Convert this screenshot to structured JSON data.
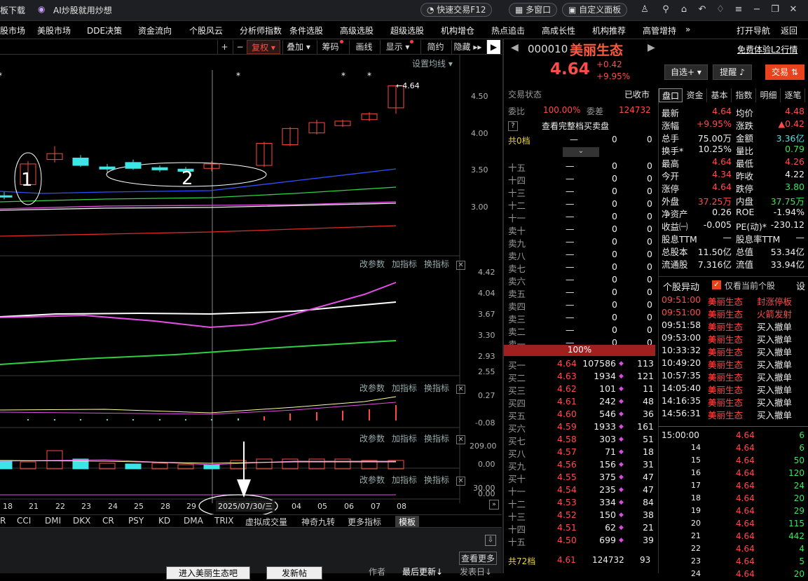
{
  "topbar": {
    "left_label": "板下载",
    "promo": "AI炒股就用炒想",
    "quick_trade": "快速交易F12",
    "multi_window": "多窗口",
    "custom_panel": "自定义面板"
  },
  "menu": [
    "股市场",
    "美股市场",
    "DDE决策",
    "资金流向",
    "个股风云",
    "分析师指数",
    "条件选股",
    "高级选股",
    "超级选股",
    "机构增仓",
    "热点追击",
    "高成长性",
    "机构推荐",
    "高管增持",
    "»",
    "打开导航",
    "返回"
  ],
  "chart_toolbar": {
    "plus": "+",
    "minus": "−",
    "fuquan": "复权",
    "diejia": "叠加",
    "chouma": "筹码",
    "huaxian": "画线",
    "xianshi": "显示",
    "jianyue": "简约",
    "yincang": "隐藏"
  },
  "ma_setting": "设置均线",
  "price_axis": [
    "4.50",
    "4.00",
    "3.50",
    "3.00"
  ],
  "vol_axis": [
    "4.42",
    "4.04",
    "3.67",
    "3.30",
    "2.93",
    "2.55"
  ],
  "p3_axis": [
    "0.27",
    "-0.08"
  ],
  "p4_axis": [
    "209.00",
    "0.00"
  ],
  "p5_axis": [
    "30.00",
    "0.00"
  ],
  "panel_menu": {
    "params": "改参数",
    "add": "加指标",
    "swap": "换指标",
    "close": "X"
  },
  "last_price_label": "4.64",
  "annot1": "1",
  "annot2": "2",
  "x_dates": [
    "18",
    "21",
    "22",
    "23",
    "24",
    "25",
    "28",
    "29",
    "04",
    "05",
    "06",
    "07",
    "08"
  ],
  "cursor_date": "2025/07/30/三",
  "indicator_tabs": [
    "R",
    "CCI",
    "DMI",
    "DKX",
    "CR",
    "PSY",
    "KD",
    "DMA",
    "TRIX",
    "虚拟成交量",
    "神奇九转",
    "更多指标",
    "模板"
  ],
  "bottom": {
    "see_more": "查看更多",
    "enter_bar": "进入美丽生态吧",
    "post": "发新帖",
    "author": "作者",
    "last_update": "最后更新↓",
    "post_date": "发表日↓"
  },
  "chart_data": {
    "type": "candlestick",
    "title": "",
    "candles": [
      {
        "o": 3.15,
        "h": 3.2,
        "l": 3.1,
        "c": 3.13
      },
      {
        "o": 3.3,
        "h": 3.62,
        "l": 3.28,
        "c": 3.58
      },
      {
        "o": 3.64,
        "h": 3.82,
        "l": 3.6,
        "c": 3.72
      },
      {
        "o": 3.66,
        "h": 3.7,
        "l": 3.54,
        "c": 3.56
      },
      {
        "o": 3.54,
        "h": 3.58,
        "l": 3.47,
        "c": 3.51
      },
      {
        "o": 3.6,
        "h": 3.64,
        "l": 3.5,
        "c": 3.52
      },
      {
        "o": 3.53,
        "h": 3.56,
        "l": 3.47,
        "c": 3.5
      },
      {
        "o": 3.51,
        "h": 3.54,
        "l": 3.46,
        "c": 3.48
      },
      {
        "o": 3.52,
        "h": 3.62,
        "l": 3.48,
        "c": 3.58
      },
      {
        "o": 3.56,
        "h": 3.88,
        "l": 3.54,
        "c": 3.86
      },
      {
        "o": 3.84,
        "h": 4.08,
        "l": 3.82,
        "c": 4.06
      },
      {
        "o": 4.0,
        "h": 4.18,
        "l": 3.98,
        "c": 4.14
      },
      {
        "o": 4.1,
        "h": 4.18,
        "l": 4.08,
        "c": 4.16
      },
      {
        "o": 4.18,
        "h": 4.28,
        "l": 4.16,
        "c": 4.26
      },
      {
        "o": 4.34,
        "h": 4.64,
        "l": 4.26,
        "c": 4.64
      }
    ]
  },
  "quote": {
    "code": "000010",
    "name": "美丽生态",
    "trial": "免费体验L2行情",
    "price": "4.64",
    "change": "+0.42",
    "pct": "+9.95%",
    "btn_zixuan": "自选+",
    "btn_tixing": "提醒",
    "btn_jiaoyi": "交易"
  },
  "depth": {
    "status_label": "交易状态",
    "status_val": "已收市",
    "weibi_label": "委比",
    "weibi_val": "100.00%",
    "weicha_label": "委差",
    "weicha_val": "124732",
    "full_link": "查看完整档买卖盘",
    "sell_total_label": "共0档",
    "sell_total_vals": [
      "—",
      "0",
      "0"
    ],
    "sells": [
      [
        "十五",
        "—",
        "0"
      ],
      [
        "十四",
        "—",
        "0"
      ],
      [
        "十三",
        "—",
        "0"
      ],
      [
        "十二",
        "—",
        "0"
      ],
      [
        "十一",
        "—",
        "0"
      ],
      [
        "卖十",
        "—",
        "0"
      ],
      [
        "卖九",
        "—",
        "0"
      ],
      [
        "卖八",
        "—",
        "0"
      ],
      [
        "卖七",
        "—",
        "0"
      ],
      [
        "卖六",
        "—",
        "0"
      ],
      [
        "卖五",
        "—",
        "0"
      ],
      [
        "卖四",
        "—",
        "0"
      ],
      [
        "卖三",
        "—",
        "0"
      ],
      [
        "卖二",
        "—",
        "0"
      ],
      [
        "卖一",
        "—",
        "0"
      ]
    ],
    "sells_count": [
      "0",
      "0",
      "0",
      "0",
      "0",
      "0",
      "0",
      "0",
      "0",
      "0",
      "0",
      "0",
      "0",
      "0",
      "0"
    ],
    "ratio": "100%",
    "buys": [
      [
        "买一",
        "4.64",
        "107586",
        "113"
      ],
      [
        "买二",
        "4.63",
        "1934",
        "121"
      ],
      [
        "买三",
        "4.62",
        "101",
        "11"
      ],
      [
        "买四",
        "4.61",
        "242",
        "48"
      ],
      [
        "买五",
        "4.60",
        "546",
        "36"
      ],
      [
        "买六",
        "4.59",
        "1933",
        "161"
      ],
      [
        "买七",
        "4.58",
        "303",
        "51"
      ],
      [
        "买八",
        "4.57",
        "71",
        "18"
      ],
      [
        "买九",
        "4.56",
        "156",
        "31"
      ],
      [
        "买十",
        "4.55",
        "375",
        "47"
      ],
      [
        "十一",
        "4.54",
        "235",
        "47"
      ],
      [
        "十二",
        "4.53",
        "334",
        "84"
      ],
      [
        "十三",
        "4.52",
        "150",
        "38"
      ],
      [
        "十四",
        "4.51",
        "62",
        "21"
      ],
      [
        "十五",
        "4.50",
        "699",
        "39"
      ]
    ],
    "buy_total": [
      "共72档",
      "4.61",
      "124732",
      "93"
    ]
  },
  "ftabs": [
    "盘口",
    "资金",
    "基本",
    "指数",
    "明细",
    "逐笔"
  ],
  "fund": [
    [
      "最新",
      "4.64",
      "均价",
      "4.48"
    ],
    [
      "涨幅",
      "+9.95%",
      "涨跌",
      "▲0.42"
    ],
    [
      "总手",
      "75.00万",
      "金额",
      "3.36亿"
    ],
    [
      "换手*",
      "10.25%",
      "量比",
      "0.79"
    ],
    [
      "最高",
      "4.64",
      "最低",
      "4.26"
    ],
    [
      "今开",
      "4.34",
      "昨收",
      "4.22"
    ],
    [
      "涨停",
      "4.64",
      "跌停",
      "3.80"
    ],
    [
      "外盘",
      "37.25万",
      "内盘",
      "37.75万"
    ],
    [
      "净资产",
      "0.26",
      "ROE",
      "-1.94%"
    ],
    [
      "收益㈠",
      "-0.005",
      "PE(动)*",
      "-230.12"
    ],
    [
      "股息TTM",
      "—",
      "股息率TTM",
      "—"
    ],
    [
      "总股本",
      "11.50亿",
      "总值",
      "53.34亿"
    ],
    [
      "流通股",
      "7.316亿",
      "流值",
      "33.94亿"
    ]
  ],
  "alerts_hdr": {
    "title": "个股异动",
    "only_current": "仅看当前个股",
    "settings": "设"
  },
  "alerts": [
    [
      "09:51:00",
      "美丽生态",
      "封涨停板"
    ],
    [
      "09:51:00",
      "美丽生态",
      "火箭发射"
    ],
    [
      "09:51:58",
      "美丽生态",
      "买入撤单"
    ],
    [
      "09:53:00",
      "美丽生态",
      "买入撤单"
    ],
    [
      "10:33:32",
      "美丽生态",
      "买入撤单"
    ],
    [
      "10:49:20",
      "美丽生态",
      "买入撤单"
    ],
    [
      "10:57:35",
      "美丽生态",
      "买入撤单"
    ],
    [
      "14:05:40",
      "美丽生态",
      "买入撤单"
    ],
    [
      "14:16:35",
      "美丽生态",
      "买入撤单"
    ],
    [
      "14:56:31",
      "美丽生态",
      "买入撤单"
    ]
  ],
  "ticks": [
    [
      "15:00:00",
      "4.64",
      "6"
    ],
    [
      "14",
      "4.64",
      "6"
    ],
    [
      "15",
      "4.64",
      "50"
    ],
    [
      "16",
      "4.64",
      "120"
    ],
    [
      "17",
      "4.64",
      "24"
    ],
    [
      "18",
      "4.64",
      "20"
    ],
    [
      "19",
      "4.64",
      "29"
    ],
    [
      "20",
      "4.64",
      "115"
    ],
    [
      "21",
      "4.64",
      "442"
    ],
    [
      "22",
      "4.64",
      "4"
    ],
    [
      "23",
      "4.64",
      "5"
    ],
    [
      "24",
      "4.64",
      "20"
    ]
  ]
}
